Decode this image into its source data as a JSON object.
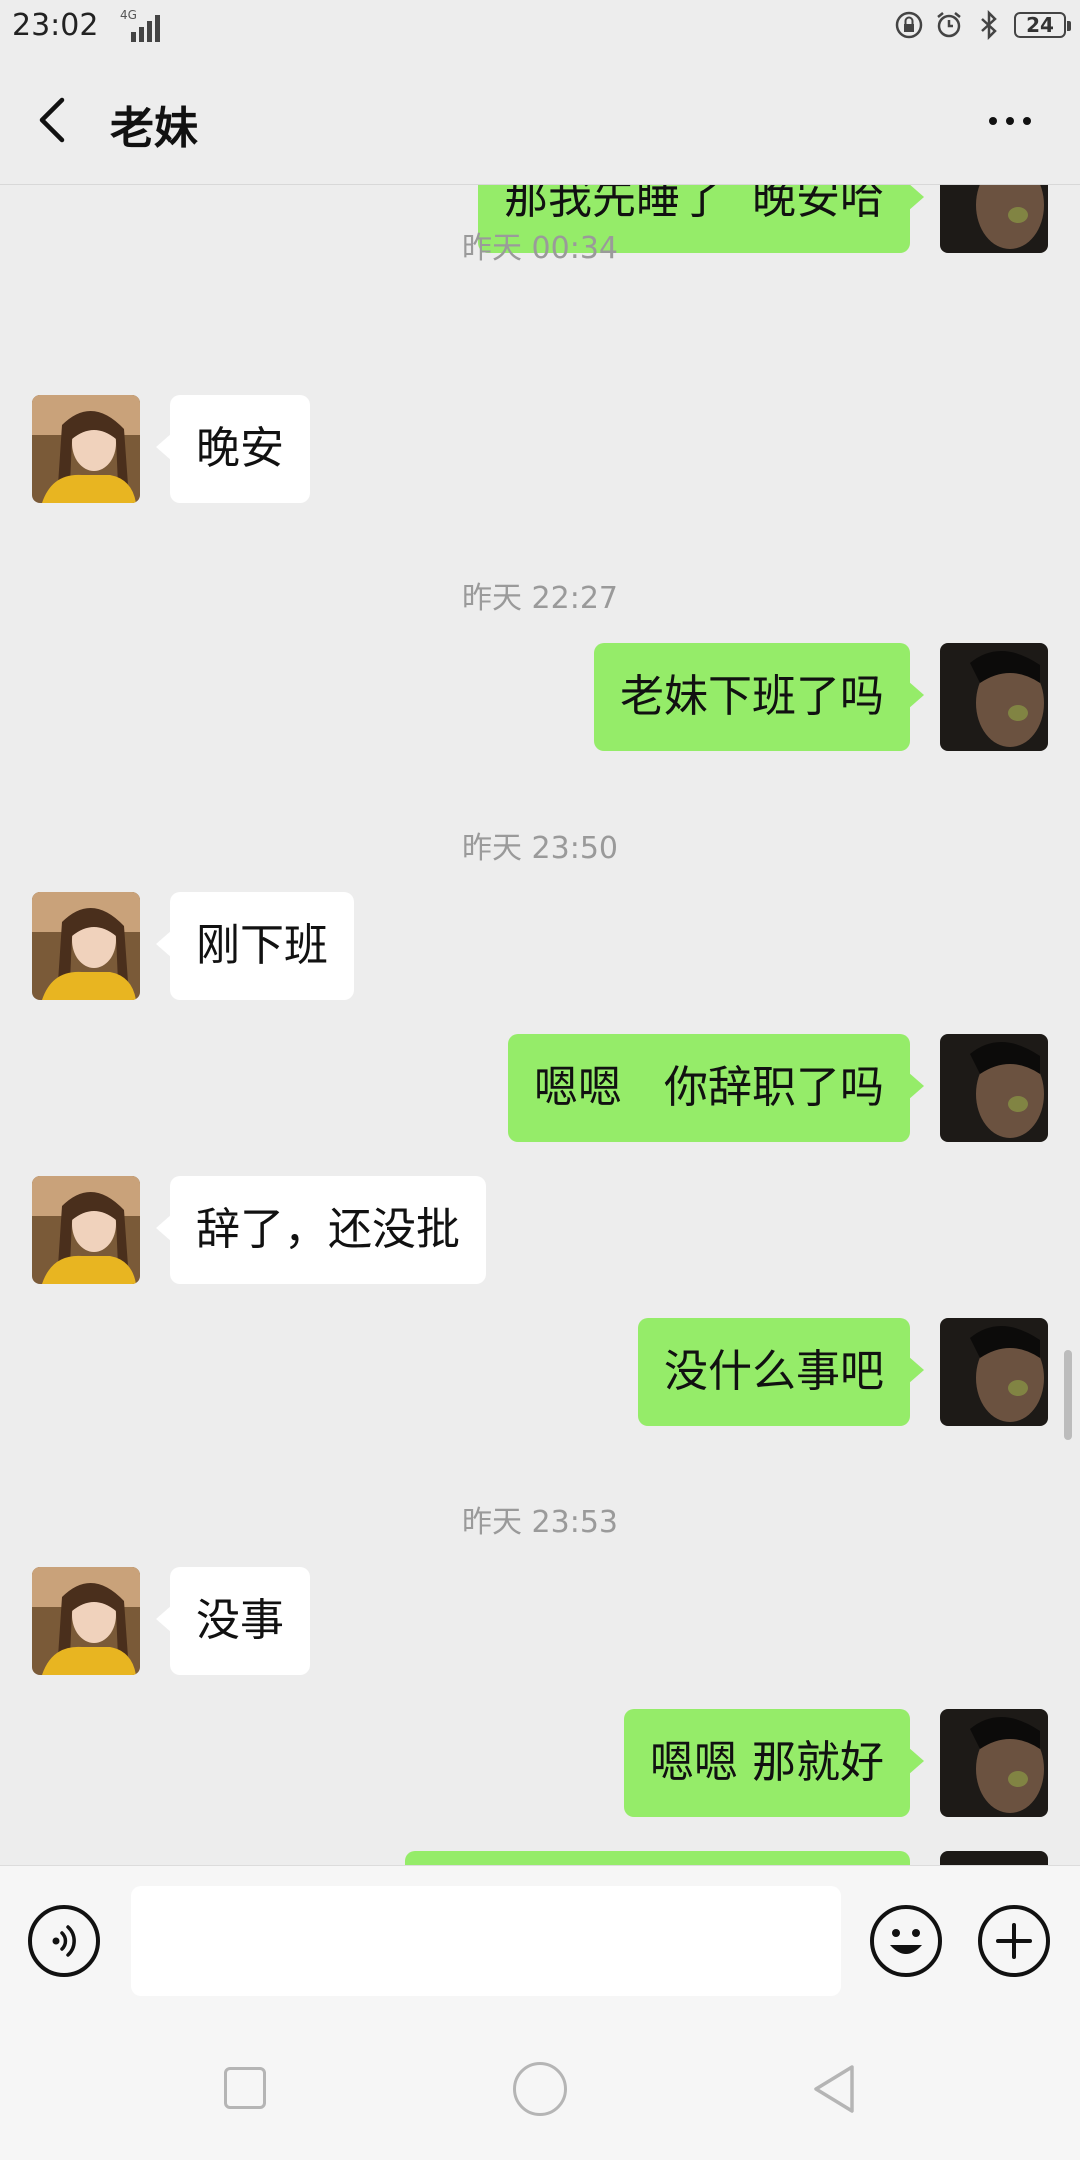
{
  "status_bar": {
    "time": "23:02",
    "network": "4G",
    "battery": "24"
  },
  "header": {
    "title": "老妹"
  },
  "colors": {
    "sent_bubble": "#95ec69",
    "received_bubble": "#ffffff",
    "background": "#ededed"
  },
  "messages": [
    {
      "type": "sent",
      "text": "那我先睡了  晚安哈"
    },
    {
      "type": "time",
      "text": "昨天 00:34"
    },
    {
      "type": "received",
      "text": "晚安"
    },
    {
      "type": "time",
      "text": "昨天 22:27"
    },
    {
      "type": "sent",
      "text": "老妹下班了吗"
    },
    {
      "type": "time",
      "text": "昨天 23:50"
    },
    {
      "type": "received",
      "text": "刚下班"
    },
    {
      "type": "sent",
      "text": "嗯嗯   你辞职了吗"
    },
    {
      "type": "received",
      "text": "辞了，还没批"
    },
    {
      "type": "sent",
      "text": "没什么事吧"
    },
    {
      "type": "time",
      "text": "昨天 23:53"
    },
    {
      "type": "received",
      "text": "没事"
    },
    {
      "type": "sent",
      "text": "嗯嗯 那就好"
    },
    {
      "type": "sent",
      "text": ""
    }
  ],
  "input": {
    "value": "",
    "placeholder": ""
  },
  "icons": {
    "back": "chevron-left-icon",
    "more": "more-icon",
    "voice": "voice-icon",
    "emoji": "emoji-icon",
    "plus": "plus-icon"
  }
}
